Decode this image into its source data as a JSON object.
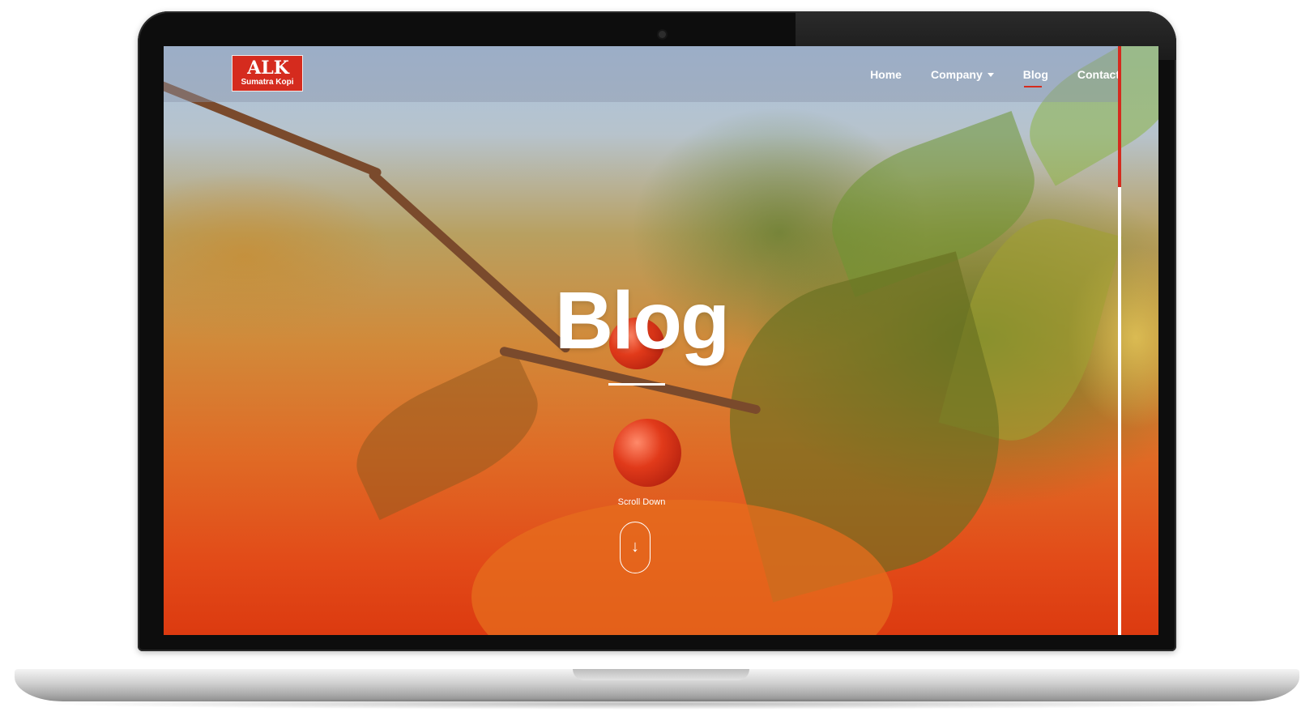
{
  "brand": {
    "logo_mark": "ALK",
    "logo_subtitle": "Sumatra Kopi",
    "accent_color": "#d52b1e"
  },
  "nav": {
    "items": [
      {
        "label": "Home"
      },
      {
        "label": "Company"
      },
      {
        "label": "Blog"
      },
      {
        "label": "Contact"
      }
    ],
    "active": "Blog"
  },
  "hero": {
    "title": "Blog",
    "scroll_label": "Scroll Down",
    "scroll_icon": "arrow-down-icon",
    "scroll_glyph": "↓"
  }
}
